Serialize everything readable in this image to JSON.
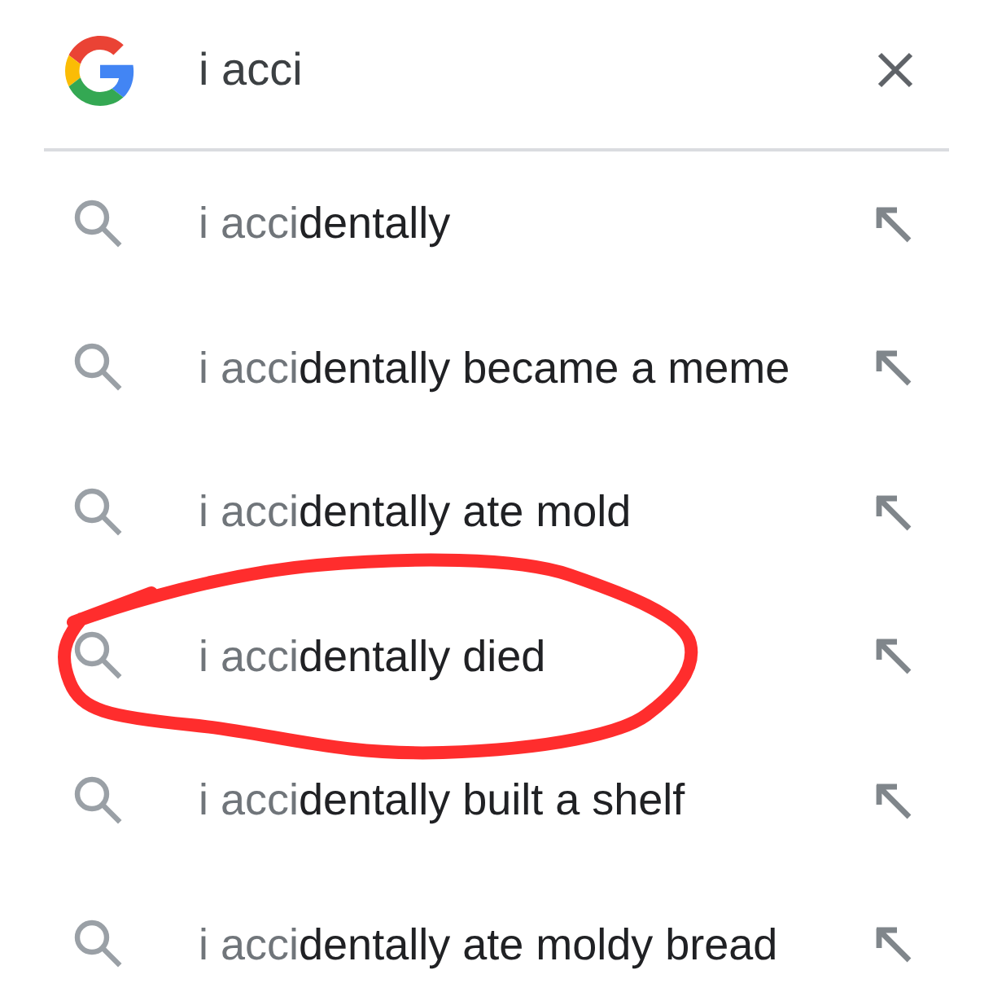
{
  "search": {
    "query": "i acci"
  },
  "suggestions": [
    {
      "typed": "i acci",
      "completion": "dentally",
      "circled": false
    },
    {
      "typed": "i acci",
      "completion": "dentally became a meme",
      "circled": false
    },
    {
      "typed": "i acci",
      "completion": "dentally ate mold",
      "circled": false
    },
    {
      "typed": "i acci",
      "completion": "dentally died",
      "circled": true
    },
    {
      "typed": "i acci",
      "completion": "dentally built a shelf",
      "circled": false
    },
    {
      "typed": "i acci",
      "completion": "dentally ate moldy bread",
      "circled": false
    }
  ]
}
